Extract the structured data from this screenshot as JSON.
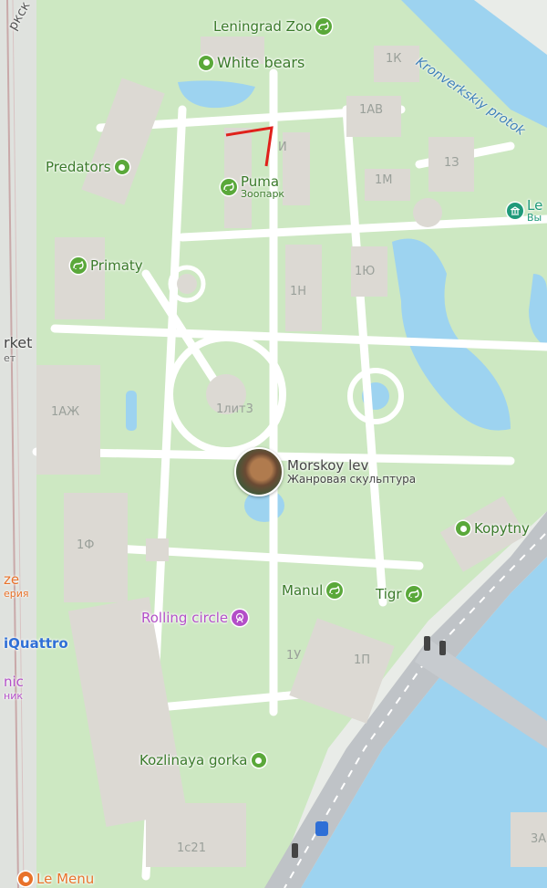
{
  "colors": {
    "park": "#cde8c2",
    "water": "#9dd3f0",
    "building": "#dcd9d3",
    "path": "#ffffff",
    "poi_green": "#5aa83a",
    "poi_purple": "#b34fc8",
    "poi_orange": "#e8722a",
    "route_red": "#e0211b"
  },
  "river": {
    "name": "Kronverkskiy protok"
  },
  "edge_labels": {
    "top_left_fragment": "ркск",
    "market": "rket",
    "market_sub": "ет",
    "ze": "ze",
    "ze_sub": "ерия",
    "quattro": "iQuattro",
    "nic": "nic",
    "nic_sub": "ник",
    "le_right": "Le",
    "le_right_sub": "Вы",
    "le_menu": "Le Menu"
  },
  "pois": {
    "leningrad_zoo": "Leningrad Zoo",
    "white_bears": "White bears",
    "predators": "Predators",
    "puma": "Puma",
    "puma_sub": "Зоопарк",
    "primaty": "Primaty",
    "morskoy_lev": "Morskoy lev",
    "morskoy_lev_sub": "Жанровая скульптура",
    "kopytny": "Kopytny",
    "manul": "Manul",
    "tigr": "Tigr",
    "rolling_circle": "Rolling circle",
    "kozlinaya_gorka": "Kozlinaya gorka"
  },
  "buildings": {
    "b1k": "1К",
    "b1ab": "1АВ",
    "b1i": "И",
    "b1z": "1З",
    "b1m": "1М",
    "b1yu": "1Ю",
    "b1n": "1Н",
    "b1azh": "1АЖ",
    "b1lit3": "1лит3",
    "b1f": "1Ф",
    "b1u": "1У",
    "b1p": "1П",
    "b1s21": "1с21",
    "b3a": "3А"
  }
}
